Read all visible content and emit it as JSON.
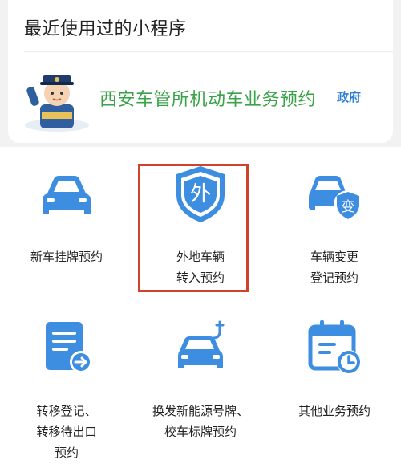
{
  "recent": {
    "title": "最近使用过的小程序",
    "mini_program": {
      "name": "西安车管所机动车业务预约",
      "badge": "政府"
    }
  },
  "services": [
    {
      "id": "new-car-plate",
      "icon": "car-icon",
      "lines": [
        "新车挂牌预约"
      ]
    },
    {
      "id": "out-of-town-transfer",
      "icon": "shield-wai-icon",
      "badge": "外",
      "lines": [
        "外地车辆",
        "转入预约"
      ],
      "highlighted": true
    },
    {
      "id": "vehicle-change",
      "icon": "car-change-icon",
      "badge": "变",
      "lines": [
        "车辆变更",
        "登记预约"
      ]
    },
    {
      "id": "transfer-registration",
      "icon": "document-transfer-icon",
      "lines": [
        "转移登记、",
        "转移待出口",
        "预约"
      ]
    },
    {
      "id": "new-energy-plate",
      "icon": "ev-car-icon",
      "lines": [
        "换发新能源号牌、",
        "校车标牌预约"
      ]
    },
    {
      "id": "other-services",
      "icon": "calendar-clock-icon",
      "lines": [
        "其他业务预约"
      ]
    }
  ],
  "colors": {
    "accent_blue": "#3d8ee0",
    "mini_green": "#3aa34a",
    "highlight_red": "#d0432b"
  }
}
